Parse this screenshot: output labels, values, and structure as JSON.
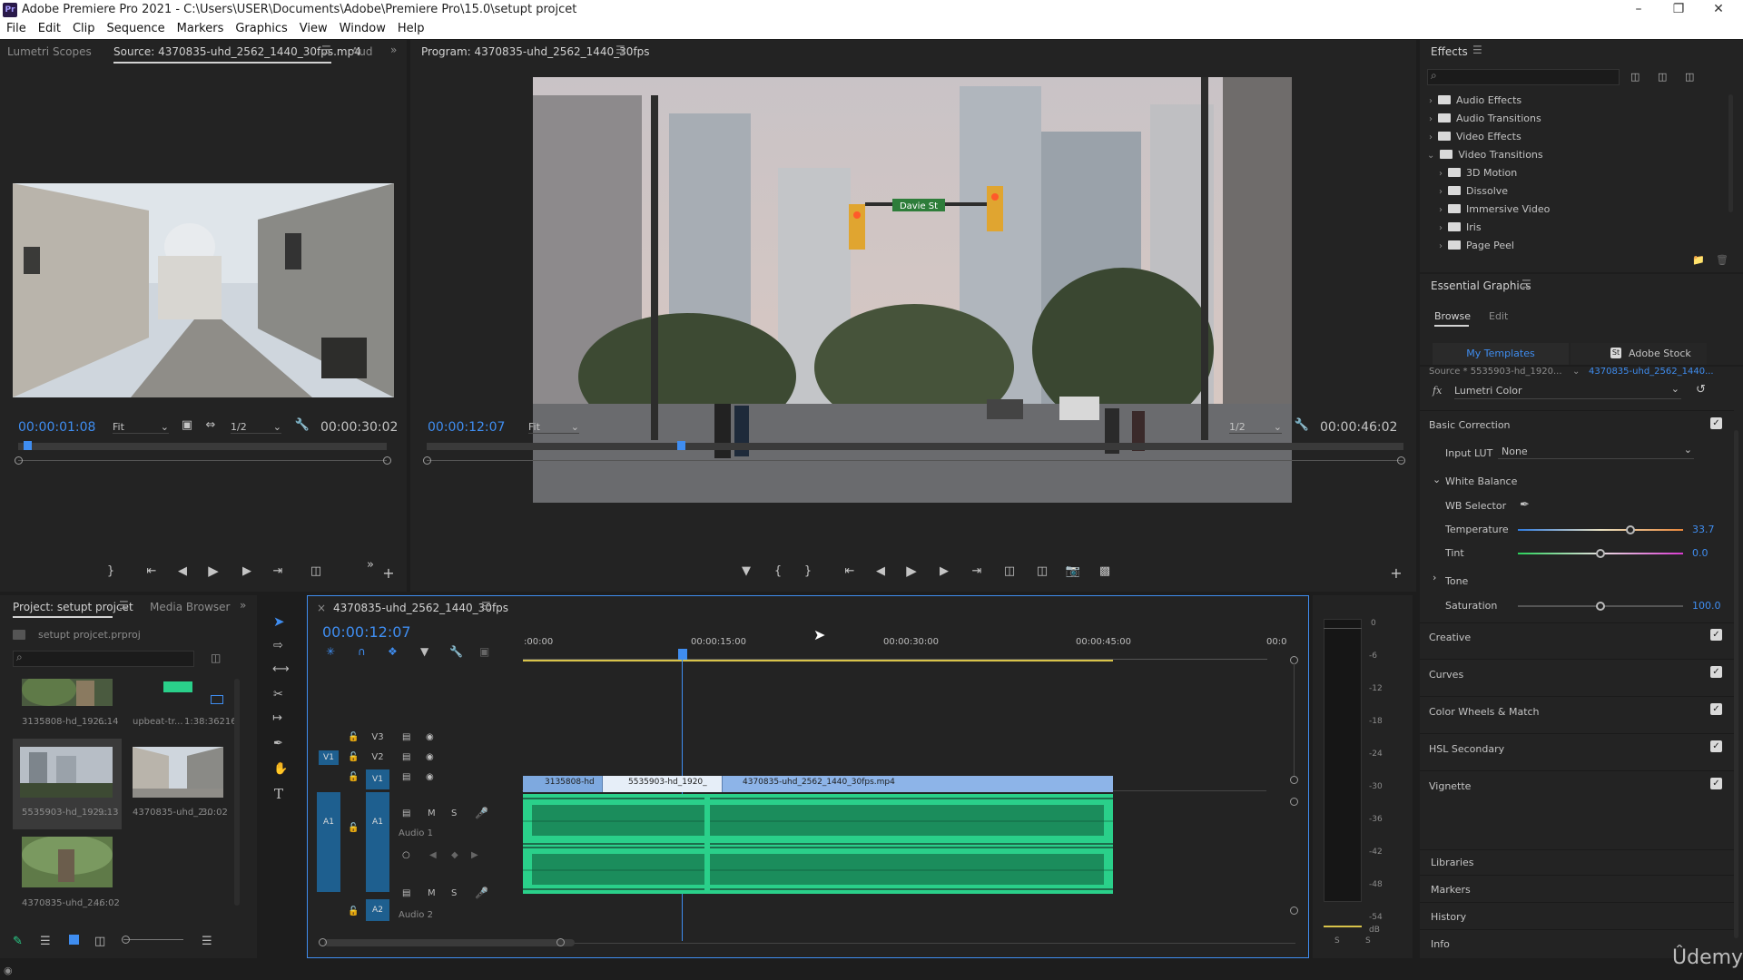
{
  "window": {
    "title": "Adobe Premiere Pro 2021 - C:\\Users\\USER\\Documents\\Adobe\\Premiere Pro\\15.0\\setupt projcet",
    "logo": "Pr"
  },
  "menu": [
    "File",
    "Edit",
    "Clip",
    "Sequence",
    "Markers",
    "Graphics",
    "View",
    "Window",
    "Help"
  ],
  "source_panel": {
    "tabs": [
      "Lumetri Scopes",
      "Source: 4370835-uhd_2562_1440_30fps.mp4",
      "Aud"
    ],
    "timecode": "00:00:01:08",
    "fit": "Fit",
    "resolution": "1/2",
    "duration": "00:00:30:02"
  },
  "program_panel": {
    "title": "Program: 4370835-uhd_2562_1440_30fps",
    "timecode": "00:00:12:07",
    "fit": "Fit",
    "resolution": "1/2",
    "duration": "00:00:46:02",
    "street_sign": "Davie St"
  },
  "project_panel": {
    "tabs": [
      "Project: setupt projcet",
      "Media Browser"
    ],
    "file": "setupt projcet.prproj",
    "items": [
      {
        "name": "3135808-hd_192...",
        "duration": "6:14"
      },
      {
        "name": "upbeat-tr...",
        "duration": "1:38:36216"
      },
      {
        "name": "5535903-hd_192...",
        "duration": "9:13"
      },
      {
        "name": "4370835-uhd_2...",
        "duration": "30:02"
      },
      {
        "name": "4370835-uhd_2...",
        "duration": "46:02"
      }
    ]
  },
  "timeline": {
    "tab": "4370835-uhd_2562_1440_30fps",
    "timecode": "00:00:12:07",
    "ruler": [
      ":00:00",
      "00:00:15:00",
      "00:00:30:00",
      "00:00:45:00",
      "00:0"
    ],
    "tracks": {
      "v3": "V3",
      "v2": "V2",
      "v1": "V1",
      "a1": "A1",
      "a2": "A2",
      "src_v1": "V1",
      "src_a1": "A1",
      "a1_name": "Audio 1",
      "a2_name": "Audio 2",
      "m": "M",
      "s": "S"
    },
    "clips": [
      "3135808-hd",
      "5535903-hd_1920_",
      "4370835-uhd_2562_1440_30fps.mp4"
    ]
  },
  "audio_meter": {
    "scale": [
      "0",
      "-6",
      "-12",
      "-18",
      "-24",
      "-30",
      "-36",
      "-42",
      "-48",
      "-54",
      "dB"
    ],
    "solo": [
      "S",
      "S"
    ]
  },
  "effects_panel": {
    "title": "Effects",
    "tree": [
      {
        "label": "Audio Effects",
        "open": false,
        "indent": 0
      },
      {
        "label": "Audio Transitions",
        "open": false,
        "indent": 0
      },
      {
        "label": "Video Effects",
        "open": false,
        "indent": 0
      },
      {
        "label": "Video Transitions",
        "open": true,
        "indent": 0
      },
      {
        "label": "3D Motion",
        "open": false,
        "indent": 1
      },
      {
        "label": "Dissolve",
        "open": false,
        "indent": 1
      },
      {
        "label": "Immersive Video",
        "open": false,
        "indent": 1
      },
      {
        "label": "Iris",
        "open": false,
        "indent": 1
      },
      {
        "label": "Page Peel",
        "open": false,
        "indent": 1
      }
    ]
  },
  "essential_graphics": {
    "title": "Essential Graphics",
    "tabs": [
      "Browse",
      "Edit"
    ],
    "subtabs": [
      "My Templates",
      "Adobe Stock"
    ],
    "source": "Source * 5535903-hd_1920...",
    "seq": "4370835-uhd_2562_1440...",
    "fx": "Lumetri Color"
  },
  "lumetri": {
    "basic_correction": "Basic Correction",
    "input_lut_label": "Input LUT",
    "input_lut_value": "None",
    "white_balance": "White Balance",
    "wb_selector": "WB Selector",
    "temperature_label": "Temperature",
    "temperature_value": "33.7",
    "temperature_level": 0.68,
    "tint_label": "Tint",
    "tint_value": "0.0",
    "tint_level": 0.5,
    "tone": "Tone",
    "saturation_label": "Saturation",
    "saturation_value": "100.0",
    "saturation_level": 0.5,
    "sections": [
      "Creative",
      "Curves",
      "Color Wheels & Match",
      "HSL Secondary",
      "Vignette"
    ]
  },
  "bottom_panels": [
    "Libraries",
    "Markers",
    "History",
    "Info"
  ],
  "watermark": "Ûdemy",
  "colors": {
    "accent_blue": "#3f8df0",
    "audio_green": "#2ad08a",
    "video_clip": "#8db4e8",
    "track_blue": "#1e5f8f"
  }
}
